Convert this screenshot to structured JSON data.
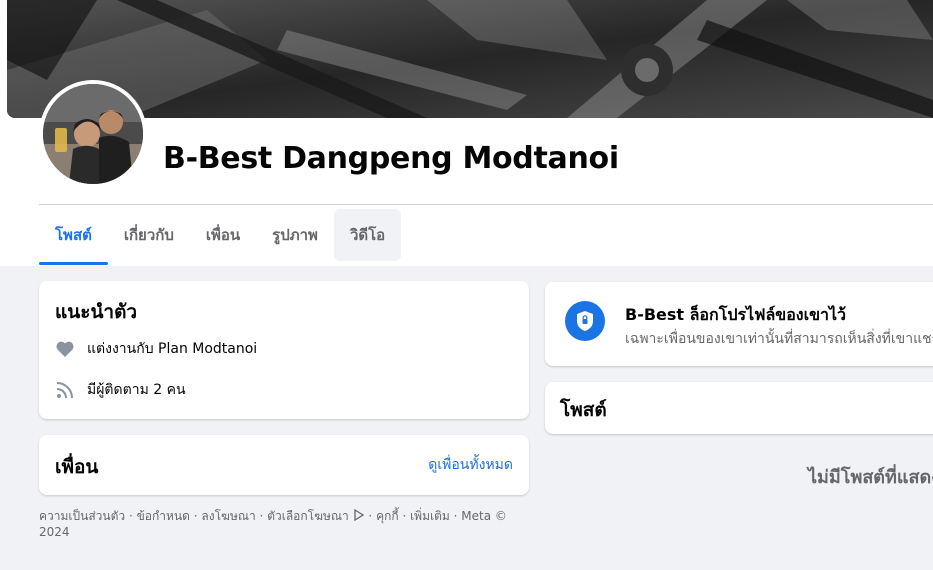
{
  "profile": {
    "name": "B-Best Dangpeng Modtanoi"
  },
  "tabs": [
    {
      "label": "โพสต์",
      "active": true
    },
    {
      "label": "เกี่ยวกับ"
    },
    {
      "label": "เพื่อน"
    },
    {
      "label": "รูปภาพ"
    },
    {
      "label": "วิดีโอ",
      "hovered": true
    }
  ],
  "intro": {
    "title": "แนะนำตัว",
    "relationship": "แต่งงานกับ Plan Modtanoi",
    "followers": "มีผู้ติดตาม 2 คน",
    "icons": [
      "heart-icon",
      "followers-icon"
    ]
  },
  "friends": {
    "title": "เพื่อน",
    "see_all": "ดูเพื่อนทั้งหมด"
  },
  "footer": {
    "privacy": "ความเป็นส่วนตัว",
    "terms": "ข้อกำหนด",
    "advertising": "ลงโฆษณา",
    "ad_choices": "ตัวเลือกโฆษณา",
    "cookies": "คุกกี้",
    "more": "เพิ่มเติม",
    "meta": "Meta © 2024"
  },
  "locked_profile": {
    "title": "B-Best ล็อกโปรไฟล์ของเขาไว้",
    "subtitle": "เฉพาะเพื่อนของเขาเท่านั้นที่สามารถเห็นสิ่งที่เขาแชร์"
  },
  "posts": {
    "title": "โพสต์",
    "empty": "ไม่มีโพสต์ที่แสดง"
  },
  "colors": {
    "accent": "#1b74e4",
    "link": "#216fdb",
    "background": "#f0f2f5",
    "secondary_text": "#65676b"
  }
}
